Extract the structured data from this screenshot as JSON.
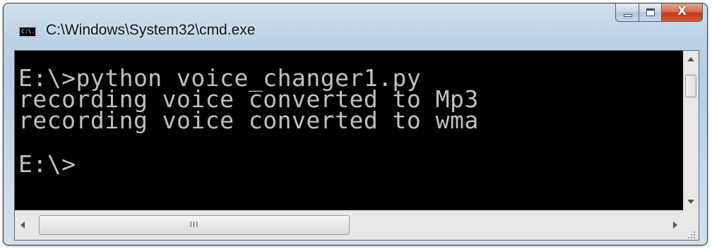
{
  "window": {
    "title": "C:\\Windows\\System32\\cmd.exe",
    "icon": "cmd-icon",
    "icon_text": "C:\\.",
    "close_glyph": "X"
  },
  "console": {
    "lines": [
      "E:\\>python voice_changer1.py",
      "recording voice converted to Mp3",
      "recording voice converted to wma",
      "",
      "E:\\>"
    ],
    "foreground": "#c0c0c0",
    "background": "#000000"
  },
  "scrollbar": {
    "horizontal_grip": "III"
  }
}
